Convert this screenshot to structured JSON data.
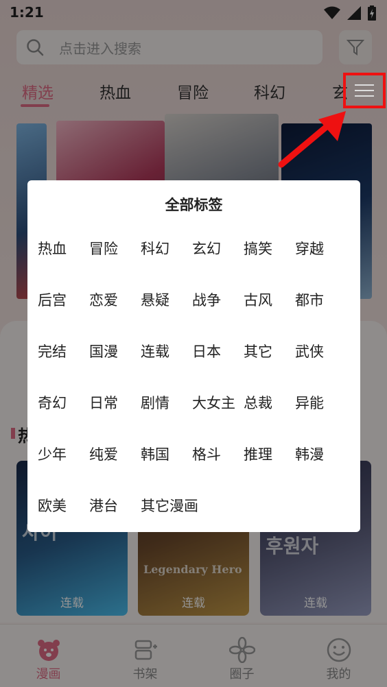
{
  "status_bar": {
    "time": "1:21"
  },
  "search": {
    "placeholder": "点击进入搜索"
  },
  "tabs": [
    {
      "label": "精选",
      "active": true
    },
    {
      "label": "热血"
    },
    {
      "label": "冒险"
    },
    {
      "label": "科幻"
    },
    {
      "label": "玄"
    }
  ],
  "section": {
    "title": "热"
  },
  "comics": [
    {
      "cover_text": "사이",
      "status": "连载"
    },
    {
      "cover_text": "Legendary Hero",
      "status": "连载"
    },
    {
      "cover_text": "후원자",
      "status": "连载"
    }
  ],
  "bottom_nav": [
    {
      "label": "漫画",
      "icon": "bear-icon",
      "active": true
    },
    {
      "label": "书架",
      "icon": "bookshelf-icon"
    },
    {
      "label": "圈子",
      "icon": "circle-icon"
    },
    {
      "label": "我的",
      "icon": "smile-icon"
    }
  ],
  "tags_modal": {
    "title": "全部标签",
    "tags": [
      "热血",
      "冒险",
      "科幻",
      "玄幻",
      "搞笑",
      "穿越",
      "后宫",
      "恋爱",
      "悬疑",
      "战争",
      "古风",
      "都市",
      "完结",
      "国漫",
      "连载",
      "日本",
      "其它",
      "武侠",
      "奇幻",
      "日常",
      "剧情",
      "大女主",
      "总裁",
      "异能",
      "少年",
      "纯爱",
      "韩国",
      "格斗",
      "推理",
      "韩漫",
      "欧美",
      "港台",
      "其它漫画"
    ]
  },
  "colors": {
    "accent": "#e06b86",
    "annotation": "#ee1111"
  }
}
